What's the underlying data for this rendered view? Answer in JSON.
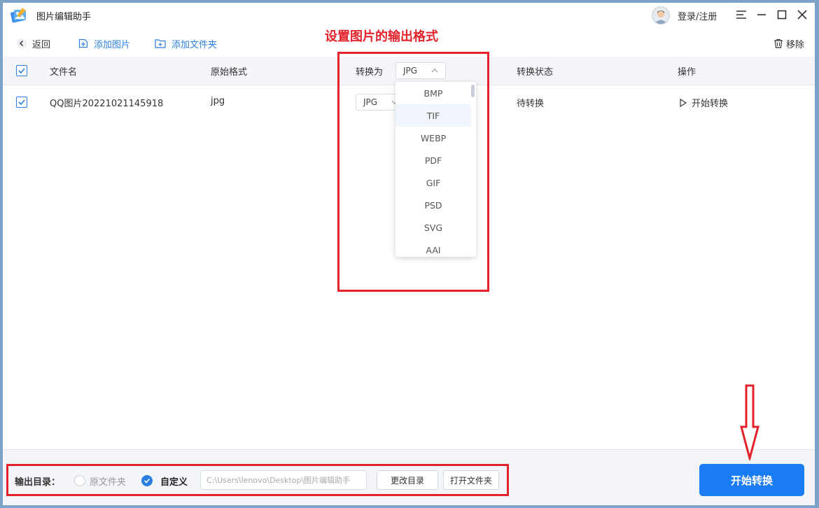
{
  "app": {
    "title": "图片编辑助手",
    "login_label": "登录/注册"
  },
  "toolbar": {
    "back": "返回",
    "add_image": "添加图片",
    "add_folder": "添加文件夹",
    "remove": "移除"
  },
  "annotation": {
    "title": "设置图片的输出格式"
  },
  "table": {
    "headers": {
      "filename": "文件名",
      "original_format": "原始格式",
      "convert_to": "转换为",
      "status": "转换状态",
      "action": "操作"
    },
    "header_format_value": "JPG",
    "rows": [
      {
        "filename": "QQ图片20221021145918",
        "original_format": "jpg",
        "target_format": "JPG",
        "status": "待转换",
        "action": "开始转换"
      }
    ]
  },
  "dropdown": {
    "options": [
      "BMP",
      "TIF",
      "WEBP",
      "PDF",
      "GIF",
      "PSD",
      "SVG",
      "AAI"
    ],
    "highlighted": "TIF"
  },
  "output": {
    "label": "输出目录：",
    "option_original": "原文件夹",
    "option_custom": "自定义",
    "path": "C:\\Users\\lenovo\\Desktop\\图片编辑助手",
    "change_dir": "更改目录",
    "open_folder": "打开文件夹"
  },
  "start_button": "开始转换",
  "colors": {
    "accent": "#1a7cf5",
    "annotation": "#e3222b"
  }
}
